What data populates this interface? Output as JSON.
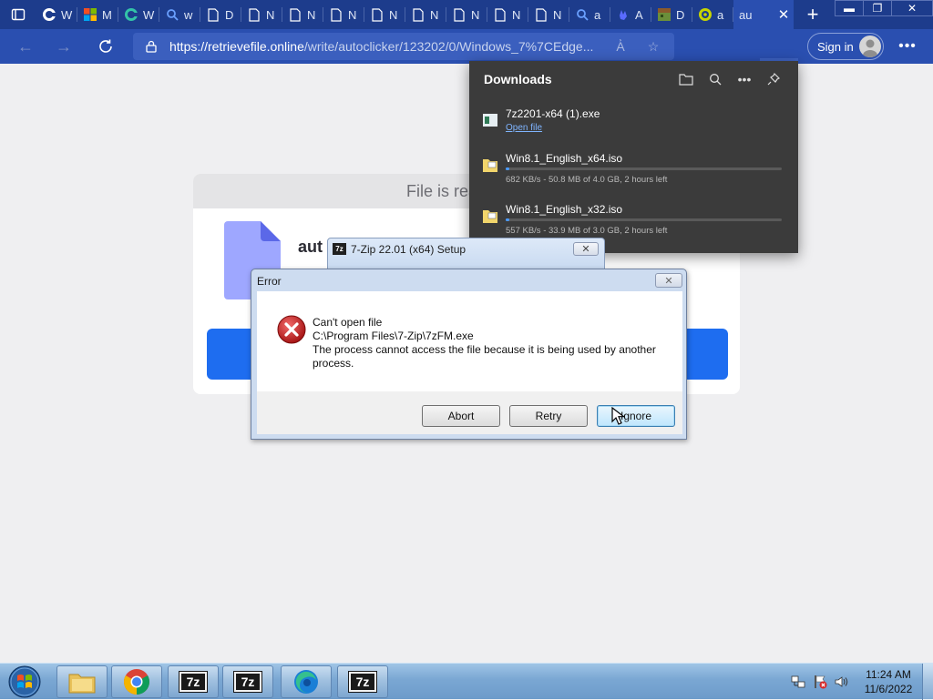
{
  "browser": {
    "tabs": [
      {
        "label": "W",
        "icon": "edge-icon"
      },
      {
        "label": "M",
        "icon": "microsoft-logo-icon"
      },
      {
        "label": "W",
        "icon": "edge-icon"
      },
      {
        "label": "w",
        "icon": "search-icon"
      },
      {
        "label": "D",
        "icon": "page-icon"
      },
      {
        "label": "N",
        "icon": "page-icon"
      },
      {
        "label": "N",
        "icon": "page-icon"
      },
      {
        "label": "N",
        "icon": "page-icon"
      },
      {
        "label": "N",
        "icon": "page-icon"
      },
      {
        "label": "N",
        "icon": "page-icon"
      },
      {
        "label": "N",
        "icon": "page-icon"
      },
      {
        "label": "N",
        "icon": "page-icon"
      },
      {
        "label": "N",
        "icon": "page-icon"
      },
      {
        "label": "a",
        "icon": "search-icon"
      },
      {
        "label": "A",
        "icon": "hand-icon"
      },
      {
        "label": "D",
        "icon": "game-icon"
      },
      {
        "label": "a",
        "icon": "autoclicker-icon"
      }
    ],
    "active_tab_label": "au",
    "new_tab_symbol": "+",
    "url_host": "https://retrievefile.online",
    "url_path": "/write/autoclicker/123202/0/Windows_7%7CEdge...",
    "sign_in_label": "Sign in"
  },
  "downloads": {
    "title": "Downloads",
    "items": [
      {
        "name": "7z2201-x64 (1).exe",
        "action": "Open file"
      },
      {
        "name": "Win8.1_English_x64.iso",
        "status": "682 KB/s - 50.8 MB of 4.0 GB, 2 hours left",
        "progress": 0.0127
      },
      {
        "name": "Win8.1_English_x32.iso",
        "status": "557 KB/s - 33.9 MB of 3.0 GB, 2 hours left",
        "progress": 0.0113
      }
    ]
  },
  "page": {
    "card_header": "File is ready to b",
    "file_name": "aut"
  },
  "setup_window": {
    "title": "7-Zip 22.01 (x64) Setup",
    "icon_text": "7z"
  },
  "error_dialog": {
    "title": "Error",
    "line1": "Can't open file",
    "line2": "C:\\Program Files\\7-Zip\\7zFM.exe",
    "line3": "The process cannot access the file because it is being used by another process.",
    "buttons": {
      "abort": "Abort",
      "retry": "Retry",
      "ignore": "Ignore"
    }
  },
  "taskbar": {
    "apps": [
      "windows-explorer",
      "chrome",
      "7-zip",
      "7-zip",
      "edge",
      "7-zip"
    ],
    "seven_zip_label": "7z",
    "time": "11:24 AM",
    "date": "11/6/2022"
  },
  "colors": {
    "edge_tab_strip": "#1d3c8c",
    "edge_toolbar": "#2a4fb0",
    "download_progress": "#4a9bff",
    "primary_button": "#1e6df0"
  }
}
